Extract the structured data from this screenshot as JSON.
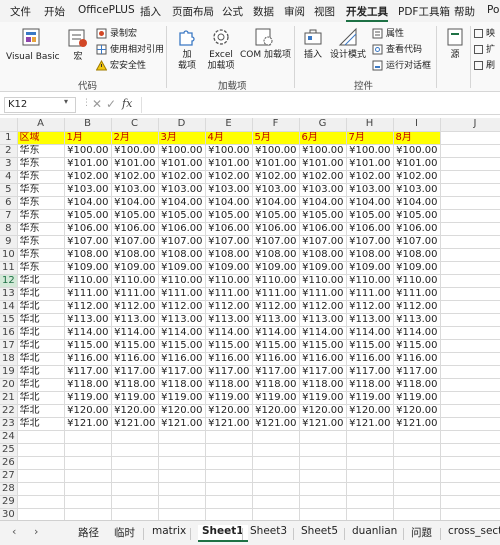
{
  "menu": [
    "文件",
    "开始",
    "OfficePLUS",
    "插入",
    "页面布局",
    "公式",
    "数据",
    "审阅",
    "视图",
    "开发工具",
    "PDF工具箱",
    "帮助",
    "Po"
  ],
  "active_menu_index": 9,
  "ribbon": {
    "visual_basic": "Visual Basic",
    "macros": "宏",
    "record_macro": "录制宏",
    "relative_ref": "使用相对引用",
    "macro_security": "宏安全性",
    "group_code": "代码",
    "addins": "加\n载项",
    "addins_a": "加",
    "addins_b": "载项",
    "excel_addins_a": "Excel",
    "excel_addins_b": "加载项",
    "com_addins": "COM 加载项",
    "group_addins": "加载项",
    "insert": "插入",
    "design_mode": "设计模式",
    "properties": "属性",
    "view_code": "查看代码",
    "run_dialog": "运行对话框",
    "group_controls": "控件",
    "source": "源",
    "right_a": "映",
    "right_b": "扩",
    "right_c": "刷"
  },
  "formula_bar": {
    "name_box": "K12",
    "fx": "fx",
    "content": ""
  },
  "columns": [
    "A",
    "B",
    "C",
    "D",
    "E",
    "F",
    "G",
    "H",
    "I",
    "J"
  ],
  "header_row": [
    "区域",
    "1月",
    "2月",
    "3月",
    "4月",
    "5月",
    "6月",
    "7月",
    "8月"
  ],
  "rows": [
    {
      "region": "华东",
      "values": [
        "¥100.00",
        "¥100.00",
        "¥100.00",
        "¥100.00",
        "¥100.00",
        "¥100.00",
        "¥100.00",
        "¥100.00"
      ]
    },
    {
      "region": "华东",
      "values": [
        "¥101.00",
        "¥101.00",
        "¥101.00",
        "¥101.00",
        "¥101.00",
        "¥101.00",
        "¥101.00",
        "¥101.00"
      ]
    },
    {
      "region": "华东",
      "values": [
        "¥102.00",
        "¥102.00",
        "¥102.00",
        "¥102.00",
        "¥102.00",
        "¥102.00",
        "¥102.00",
        "¥102.00"
      ]
    },
    {
      "region": "华东",
      "values": [
        "¥103.00",
        "¥103.00",
        "¥103.00",
        "¥103.00",
        "¥103.00",
        "¥103.00",
        "¥103.00",
        "¥103.00"
      ]
    },
    {
      "region": "华东",
      "values": [
        "¥104.00",
        "¥104.00",
        "¥104.00",
        "¥104.00",
        "¥104.00",
        "¥104.00",
        "¥104.00",
        "¥104.00"
      ]
    },
    {
      "region": "华东",
      "values": [
        "¥105.00",
        "¥105.00",
        "¥105.00",
        "¥105.00",
        "¥105.00",
        "¥105.00",
        "¥105.00",
        "¥105.00"
      ]
    },
    {
      "region": "华东",
      "values": [
        "¥106.00",
        "¥106.00",
        "¥106.00",
        "¥106.00",
        "¥106.00",
        "¥106.00",
        "¥106.00",
        "¥106.00"
      ]
    },
    {
      "region": "华东",
      "values": [
        "¥107.00",
        "¥107.00",
        "¥107.00",
        "¥107.00",
        "¥107.00",
        "¥107.00",
        "¥107.00",
        "¥107.00"
      ]
    },
    {
      "region": "华东",
      "values": [
        "¥108.00",
        "¥108.00",
        "¥108.00",
        "¥108.00",
        "¥108.00",
        "¥108.00",
        "¥108.00",
        "¥108.00"
      ]
    },
    {
      "region": "华东",
      "values": [
        "¥109.00",
        "¥109.00",
        "¥109.00",
        "¥109.00",
        "¥109.00",
        "¥109.00",
        "¥109.00",
        "¥109.00"
      ]
    },
    {
      "region": "华北",
      "values": [
        "¥110.00",
        "¥110.00",
        "¥110.00",
        "¥110.00",
        "¥110.00",
        "¥110.00",
        "¥110.00",
        "¥110.00"
      ]
    },
    {
      "region": "华北",
      "values": [
        "¥111.00",
        "¥111.00",
        "¥111.00",
        "¥111.00",
        "¥111.00",
        "¥111.00",
        "¥111.00",
        "¥111.00"
      ]
    },
    {
      "region": "华北",
      "values": [
        "¥112.00",
        "¥112.00",
        "¥112.00",
        "¥112.00",
        "¥112.00",
        "¥112.00",
        "¥112.00",
        "¥112.00"
      ]
    },
    {
      "region": "华北",
      "values": [
        "¥113.00",
        "¥113.00",
        "¥113.00",
        "¥113.00",
        "¥113.00",
        "¥113.00",
        "¥113.00",
        "¥113.00"
      ]
    },
    {
      "region": "华北",
      "values": [
        "¥114.00",
        "¥114.00",
        "¥114.00",
        "¥114.00",
        "¥114.00",
        "¥114.00",
        "¥114.00",
        "¥114.00"
      ]
    },
    {
      "region": "华北",
      "values": [
        "¥115.00",
        "¥115.00",
        "¥115.00",
        "¥115.00",
        "¥115.00",
        "¥115.00",
        "¥115.00",
        "¥115.00"
      ]
    },
    {
      "region": "华北",
      "values": [
        "¥116.00",
        "¥116.00",
        "¥116.00",
        "¥116.00",
        "¥116.00",
        "¥116.00",
        "¥116.00",
        "¥116.00"
      ]
    },
    {
      "region": "华北",
      "values": [
        "¥117.00",
        "¥117.00",
        "¥117.00",
        "¥117.00",
        "¥117.00",
        "¥117.00",
        "¥117.00",
        "¥117.00"
      ]
    },
    {
      "region": "华北",
      "values": [
        "¥118.00",
        "¥118.00",
        "¥118.00",
        "¥118.00",
        "¥118.00",
        "¥118.00",
        "¥118.00",
        "¥118.00"
      ]
    },
    {
      "region": "华北",
      "values": [
        "¥119.00",
        "¥119.00",
        "¥119.00",
        "¥119.00",
        "¥119.00",
        "¥119.00",
        "¥119.00",
        "¥119.00"
      ]
    },
    {
      "region": "华北",
      "values": [
        "¥120.00",
        "¥120.00",
        "¥120.00",
        "¥120.00",
        "¥120.00",
        "¥120.00",
        "¥120.00",
        "¥120.00"
      ]
    },
    {
      "region": "华北",
      "values": [
        "¥121.00",
        "¥121.00",
        "¥121.00",
        "¥121.00",
        "¥121.00",
        "¥121.00",
        "¥121.00",
        "¥121.00"
      ]
    }
  ],
  "total_rows_visible": 30,
  "selected_row": 12,
  "sheets": [
    "路径",
    "临时",
    "matrix",
    "Sheet1",
    "Sheet3",
    "Sheet5",
    "duanlian",
    "问题",
    "cross_secti"
  ],
  "active_sheet_index": 3,
  "accent_color": "#1e7145"
}
